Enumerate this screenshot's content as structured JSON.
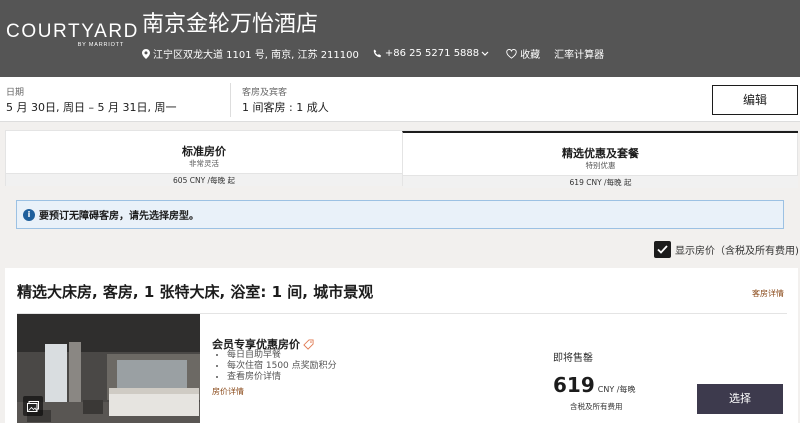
{
  "header": {
    "logo_main": "COURTYARD",
    "logo_sub": "BY MARRIOTT",
    "hotel_name": "南京金轮万怡酒店",
    "address": "江宁区双龙大道 1101 号, 南京, 江苏 211100",
    "phone": "+86 25 5271 5888",
    "favorite_label": "收藏",
    "currency_calc_label": "汇率计算器",
    "icons": [
      "location-pin-icon",
      "phone-icon",
      "chevron-down-icon",
      "heart-icon"
    ],
    "bg_color": "#555555"
  },
  "search": {
    "date_label": "日期",
    "date_value": "5 月 30日, 周日 – 5 月 31日, 周一",
    "rooms_label": "客房及宾客",
    "rooms_value": "1 间客房 : 1 成人",
    "edit_label": "编辑"
  },
  "rate_tabs": [
    {
      "title": "标准房价",
      "subtitle": "非常灵活",
      "price": "605 CNY /每晚 起"
    },
    {
      "title": "精选优惠及套餐",
      "subtitle": "特别优惠",
      "price": "619 CNY /每晚 起"
    }
  ],
  "notice": {
    "icon": "info-icon",
    "text": "要预订无障碍客房，请先选择房型。"
  },
  "show_price": {
    "checked": true,
    "label": "显示房价（含税及所有费用)"
  },
  "room": {
    "title": "精选大床房, 客房, 1 张特大床, 浴室: 1 间, 城市景观",
    "details_link": "客房详情",
    "rate_name": "会员专享优惠房价",
    "rate_tag_icon": "tag-icon",
    "benefits": [
      "每日自助早餐",
      "每次住宿 1500 点奖励积分",
      "查看房价详情"
    ],
    "price_details_link": "房价详情",
    "availability": "即将售罄",
    "price": "619",
    "price_unit": "CNY /每晚",
    "price_note": "含税及所有费用",
    "select_label": "选择",
    "select_color": "#3d3a4d"
  }
}
